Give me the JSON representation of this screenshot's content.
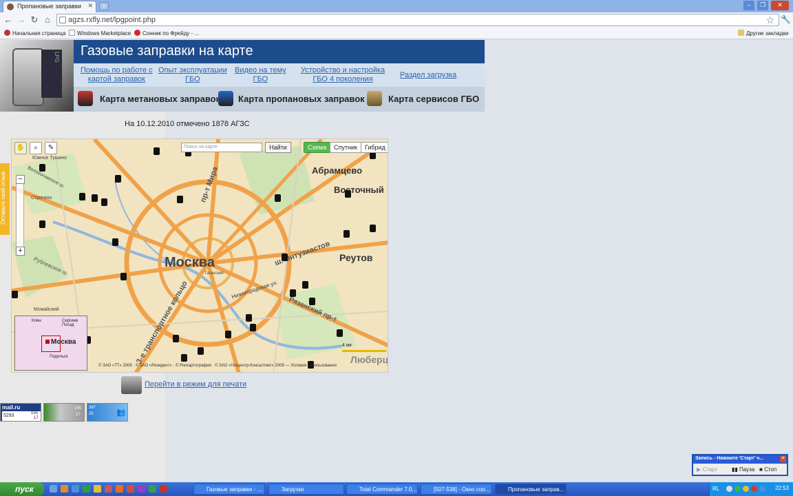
{
  "browser": {
    "tab_title": "Пропановые заправки",
    "url": "agzs.rxfly.net/lpgpoint.php",
    "bookmarks": [
      "Начальная страница",
      "Windows Marketplace",
      "Сонник по Фрейду - ..."
    ],
    "other_bookmarks": "Другие закладки"
  },
  "header": {
    "title": "Газовые заправки на карте",
    "logo_text": "LPG",
    "links": [
      {
        "line1": "Помощь по работе с",
        "line2": "картой заправок"
      },
      {
        "line1": "Опыт эксплуатации",
        "line2": "ГБО"
      },
      {
        "line1": "Видео на тему",
        "line2": "ГБО"
      },
      {
        "line1": "Устройство и настройка",
        "line2": "ГБО 4 поколения"
      },
      {
        "line1": "Раздел загрузка",
        "line2": ""
      }
    ],
    "map_nav": [
      "Карта метановых заправок",
      "Карта пропановых заправок",
      "Карта сервисов ГБО"
    ]
  },
  "status_text": "На 10.12.2010 отмечено 1878 АГЗС",
  "map": {
    "search_placeholder": "Поиск на карте",
    "find_button": "Найти",
    "layers": [
      "Схема",
      "Спутник",
      "Гибрид"
    ],
    "active_layer": "Схема",
    "labels": [
      "Москва",
      "Абрамцево",
      "Восточный",
      "Реутов",
      "Люберцы",
      "Южное Тушино",
      "Строгино",
      "Можайский",
      "Волоколамское ш.",
      "Нижегородская ул.",
      "Рязанский пр-т",
      "пр-т Мира",
      "ш. Энтузиастов",
      "Рублевское ш.",
      "Таганский",
      "3-е транспортное кольцо"
    ],
    "minimap_city": "Москва",
    "minimap_labels": [
      "Клин",
      "Сергиев Посад",
      "Подольск"
    ],
    "scale_label": "4 км",
    "copyright": "© ЗАО «ТТ» 2008 · © ЗАО «Резидент» · © Роскартография · © ЗАО «Геоцентр-Консалтинг» 2009 — Условия использования",
    "feedback_tab": "Оставьте свой отзыв"
  },
  "print_link": "Перейти в режим для печати",
  "counters": {
    "mail_brand": "mail.ru",
    "mail_values": [
      "5293",
      "155",
      "17"
    ],
    "second_values": [
      "155",
      "17"
    ],
    "third_values": [
      "387",
      "25"
    ]
  },
  "recorder": {
    "title": "Запись - Нажмите 'Старт' ч...",
    "start": "Старт",
    "pause": "Пауза",
    "stop": "Стоп"
  },
  "taskbar": {
    "start_label": "пуск",
    "tasks": [
      "Газовые заправки - ...",
      "Загрузки",
      "Total Commander 7.0...",
      "[507-538] - Окно соо...",
      "Пропановые заправ..."
    ],
    "lang": "RL",
    "clock": "22:53"
  },
  "colors": {
    "header_bg": "#1d4c8d",
    "links_bg": "#d4e2ef",
    "map_nav_bg": "#c4d0db",
    "accent_link": "#2f61a9",
    "active_layer": "#56b84f"
  }
}
